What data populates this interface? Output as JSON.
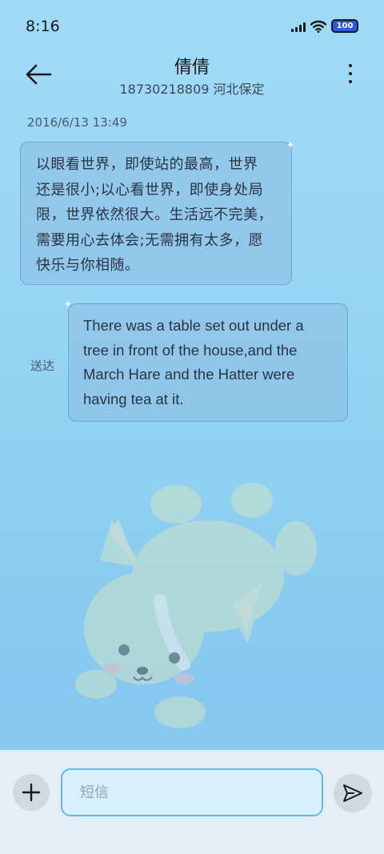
{
  "status_bar": {
    "time": "8:16",
    "battery": "100",
    "icons": [
      "signal-icon",
      "wifi-icon",
      "battery-icon"
    ]
  },
  "header": {
    "contact_name": "倩倩",
    "subtitle": "18730218809 河北保定",
    "back_icon": "back-arrow-icon",
    "more_icon": "more-vertical-icon"
  },
  "conversation": {
    "timestamp": "2016/6/13 13:49",
    "messages": [
      {
        "direction": "incoming",
        "lines": [
          "以眼看世界，即使站的最高，世界",
          "还是很小;以心看世界，即使身处局",
          "限，世界依然很大。生活远不完美，",
          "需要用心去体会;无需拥有太多，愿",
          "快乐与你相随。"
        ]
      },
      {
        "direction": "outgoing",
        "status": "送达",
        "lines": [
          "There was a table set out under a",
          "tree in front of the house,and the",
          "March Hare and the Hatter were",
          "having tea at it."
        ]
      }
    ]
  },
  "composer": {
    "placeholder": "短信",
    "value": "",
    "add_icon": "plus-icon",
    "send_icon": "send-icon"
  },
  "colors": {
    "background": "#9ad6f4",
    "bubble": "#8cbee4",
    "input_border": "#6ab6ea",
    "composer_bar": "#e4eef4"
  }
}
